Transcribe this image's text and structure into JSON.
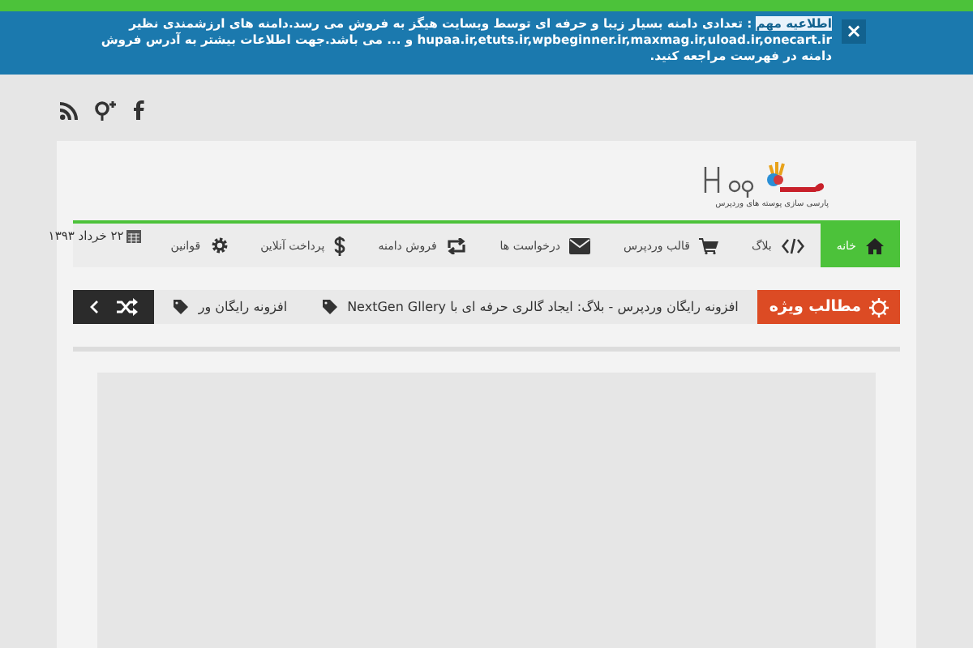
{
  "notice": {
    "label": "اطلاعیه مهم",
    "message": ": تعدادی دامنه بسیار زیبا و حرفه ای توسط وبسایت هیگز به فروش می رسد.دامنه های ارزشمندی نظیر hupaa.ir,etuts.ir,wpbeginner.ir,maxmag.ir,uload.ir,onecart.ir و ... می باشد.جهت اطلاعات بیشتر به آدرس فروش دامنه در فهرست مراجعه کنید.",
    "close": "×"
  },
  "logo": {
    "tagline": "پارسی سازی پوسته های وردپرس"
  },
  "nav": {
    "items": [
      {
        "label": "خانه",
        "selected": true
      },
      {
        "label": "بلاگ",
        "selected": false
      },
      {
        "label": "قالب وردپرس",
        "selected": false
      },
      {
        "label": "درخواست ها",
        "selected": false
      },
      {
        "label": "فروش دامنه",
        "selected": false
      },
      {
        "label": "پرداخت آنلاین",
        "selected": false
      },
      {
        "label": "قوانین",
        "selected": false
      }
    ],
    "date": "۲۲ خرداد ۱۳۹۳"
  },
  "ticker": {
    "title": "مطالب ویژه",
    "items": [
      "افزونه رایگان وردپرس - بلاگ: ایجاد گالری حرفه ای با NextGen Gllery",
      "افزونه رایگان ور"
    ]
  }
}
